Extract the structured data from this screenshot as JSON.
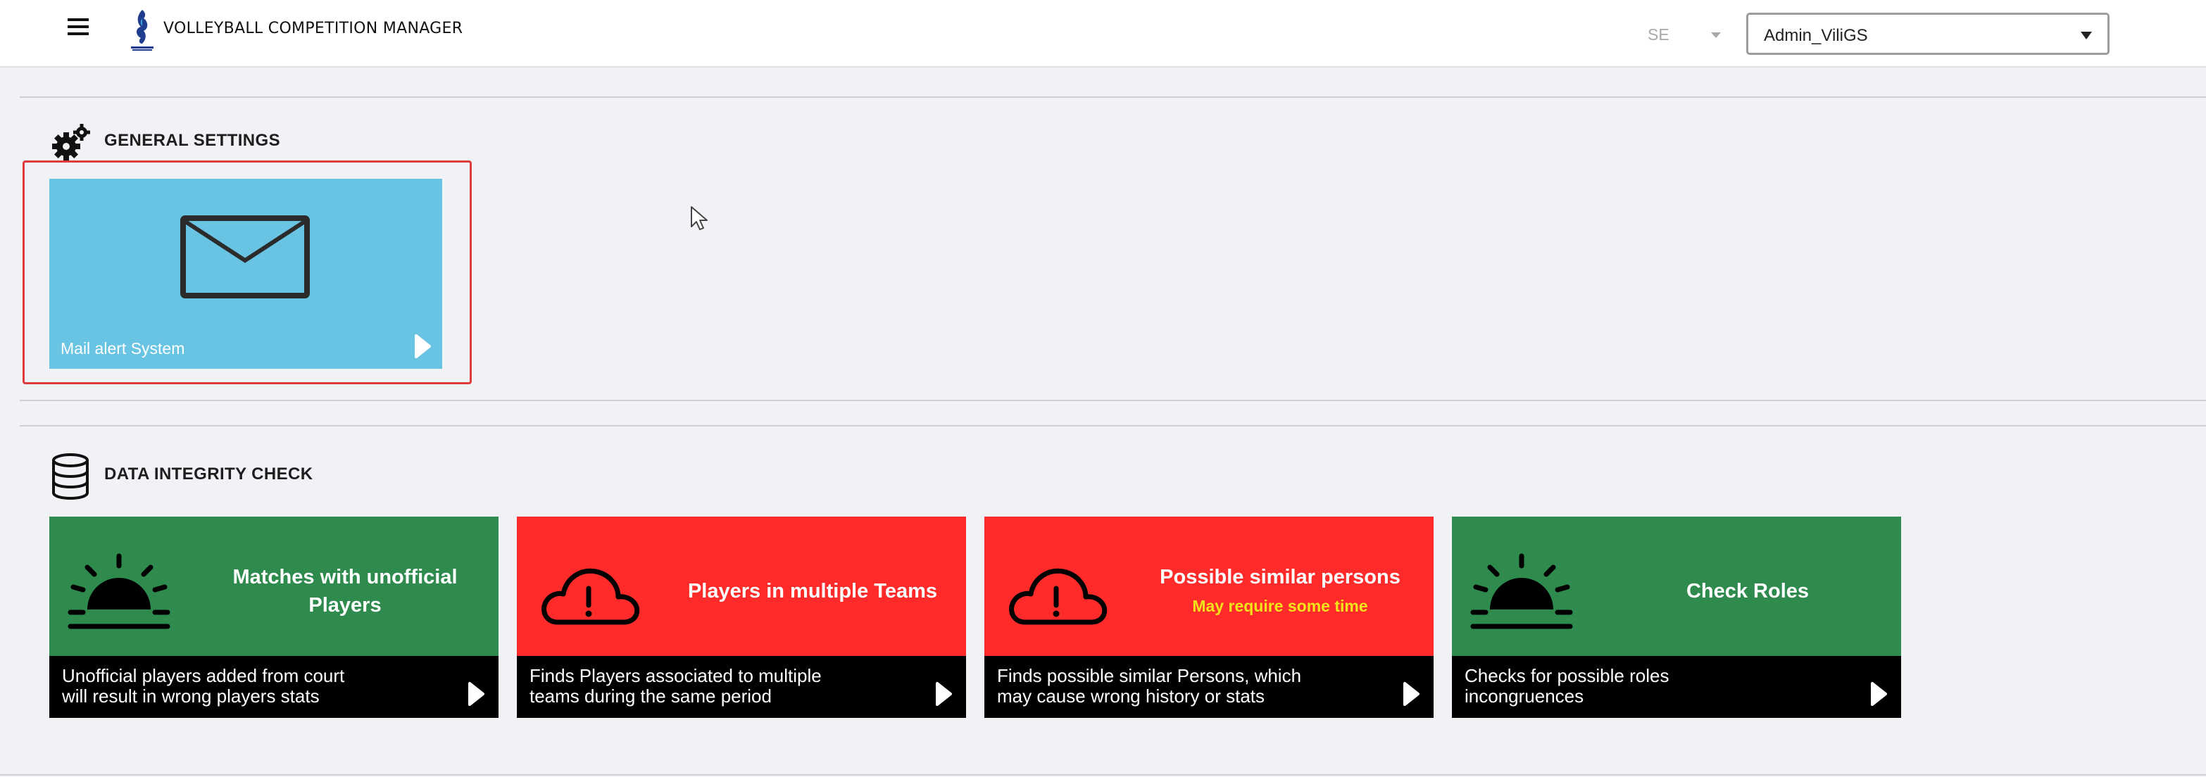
{
  "header": {
    "app_title": "VOLLEYBALL COMPETITION MANAGER",
    "language": "SE",
    "user": "Admin_ViliGS"
  },
  "icons": {
    "menu": "hamburger-icon",
    "logo": "brand-logo",
    "general_settings": "gears-icon",
    "data_integrity": "database-icon",
    "mail": "envelope-icon",
    "sunrise": "sunrise-icon",
    "cloud": "cloud-alert-icon",
    "go": "play-arrow-icon"
  },
  "colors": {
    "mail_tile": "#69c3e3",
    "ok_tile": "#2e8b4d",
    "alert_tile": "#ff2b2b",
    "tile_footer": "#000000",
    "warning_text": "#f4e21a",
    "selection_border": "#e03a3a"
  },
  "general_settings": {
    "title": "GENERAL SETTINGS",
    "cards": [
      {
        "label": "Mail alert System"
      }
    ]
  },
  "data_integrity": {
    "title": "DATA INTEGRITY CHECK",
    "tiles": [
      {
        "title_line1": "Matches with unofficial",
        "title_line2": "Players",
        "subtitle": "",
        "desc_line1": "Unofficial players added from court",
        "desc_line2": "will result in wrong players stats",
        "status": "ok"
      },
      {
        "title_line1": "Players in multiple Teams",
        "title_line2": "",
        "subtitle": "",
        "desc_line1": "Finds Players associated to multiple",
        "desc_line2": "teams during the same period",
        "status": "alert"
      },
      {
        "title_line1": "Possible similar persons",
        "title_line2": "",
        "subtitle": "May require some time",
        "desc_line1": "Finds possible similar Persons, which",
        "desc_line2": "may cause wrong history or stats",
        "status": "alert"
      },
      {
        "title_line1": "Check Roles",
        "title_line2": "",
        "subtitle": "",
        "desc_line1": "Checks for possible roles",
        "desc_line2": "incongruences",
        "status": "ok"
      }
    ]
  }
}
